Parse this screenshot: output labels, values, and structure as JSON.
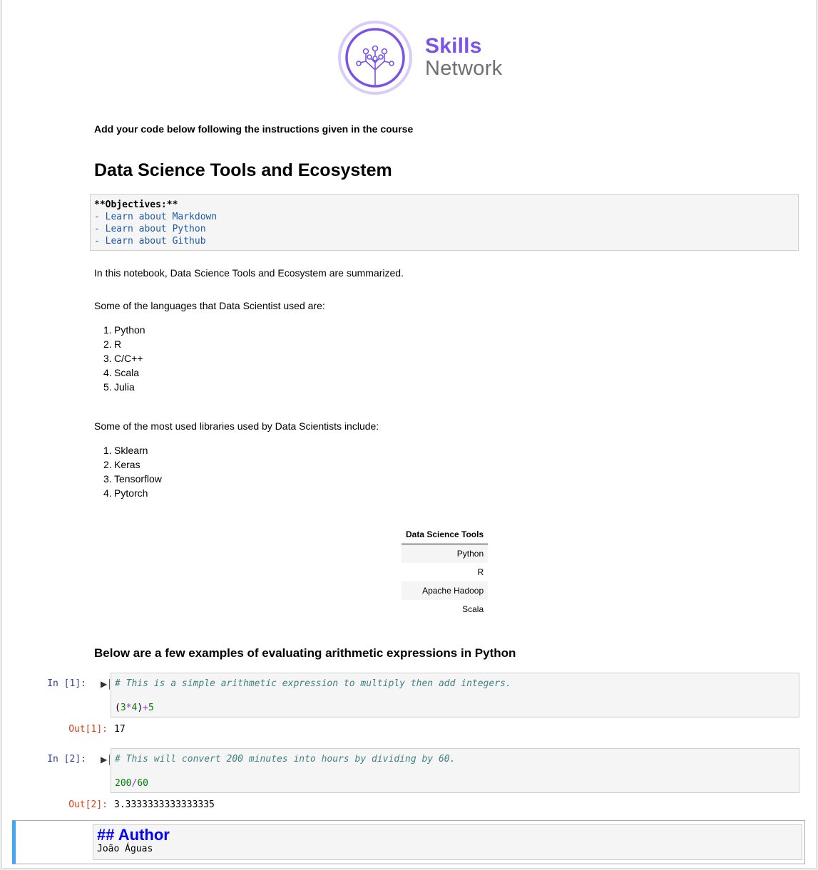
{
  "logo": {
    "line1": "Skills",
    "line2": "Network",
    "colors": {
      "primary": "#7b52e8",
      "ring": "#cdbdf6",
      "secondary": "#6f6f6f"
    },
    "icon": "tree-network-icon"
  },
  "instruction": "Add your code below following the instructions given in the course",
  "title": "Data Science Tools and Ecosystem",
  "objectives": {
    "header": "**Objectives:**",
    "items": [
      "- Learn about Markdown",
      "- Learn about Python",
      "- Learn about Github"
    ]
  },
  "intro": "In this notebook, Data Science Tools and Ecosystem are summarized.",
  "languages": {
    "intro": "Some of the languages that Data Scientist used are:",
    "items": [
      {
        "num": "1.",
        "label": "Python"
      },
      {
        "num": "2.",
        "label": "R"
      },
      {
        "num": "3.",
        "label": "C/C++"
      },
      {
        "num": "4.",
        "label": "Scala"
      },
      {
        "num": "5.",
        "label": "Julia"
      }
    ]
  },
  "libraries": {
    "intro": "Some of the most used libraries used by Data Scientists include:",
    "items": [
      {
        "num": "1.",
        "label": "Sklearn"
      },
      {
        "num": "2.",
        "label": "Keras"
      },
      {
        "num": "3.",
        "label": "Tensorflow"
      },
      {
        "num": "4.",
        "label": "Pytorch"
      }
    ]
  },
  "tools_table": {
    "header": "Data Science Tools",
    "rows": [
      "Python",
      "R",
      "Apache Hadoop",
      "Scala"
    ]
  },
  "examples_heading": "Below are a few examples of evaluating arithmetic expressions in Python",
  "cells": [
    {
      "in_prompt": "In [1]:",
      "comment": "# This is a simple arithmetic expression to multiply then add integers.",
      "code": {
        "p1": "(",
        "n1": "3",
        "o1": "*",
        "n2": "4",
        "p2": ")",
        "o2": "+",
        "n3": "5"
      },
      "out_prompt": "Out[1]:",
      "output": "17"
    },
    {
      "in_prompt": "In [2]:",
      "comment": "# This will convert 200 minutes into hours by dividing by 60.",
      "code": {
        "n1": "200",
        "o1": "/",
        "n2": "60"
      },
      "out_prompt": "Out[2]:",
      "output": "3.3333333333333335"
    }
  ],
  "author": {
    "heading": "## Author",
    "name": "João Águas"
  },
  "colors": {
    "in_prompt": "#303f9f",
    "out_prompt": "#d84315",
    "selected_cell": "#42a5f5",
    "link_blue": "#1f5aa6"
  }
}
